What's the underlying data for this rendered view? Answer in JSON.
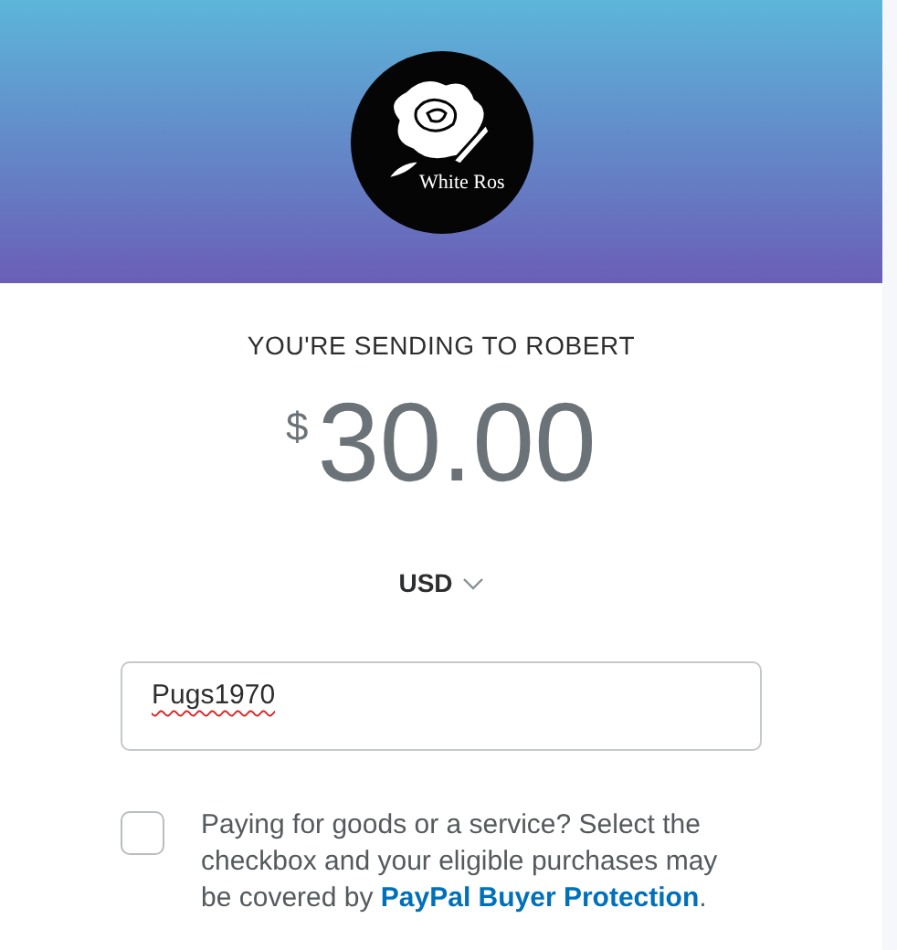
{
  "header": {
    "logo_text": "White Ros"
  },
  "recipient": {
    "heading": "YOU'RE SENDING TO ROBERT"
  },
  "amount": {
    "currency_symbol": "$",
    "value": "30.00"
  },
  "currency": {
    "code": "USD"
  },
  "note_field": {
    "value": "Pugs1970",
    "spellcheck_error": true
  },
  "buyer_protection": {
    "checked": false,
    "text": "Paying for goods or a service? Select the checkbox and your eligible purchases may be covered by",
    "link": "PayPal Buyer Protection",
    "after": "."
  }
}
